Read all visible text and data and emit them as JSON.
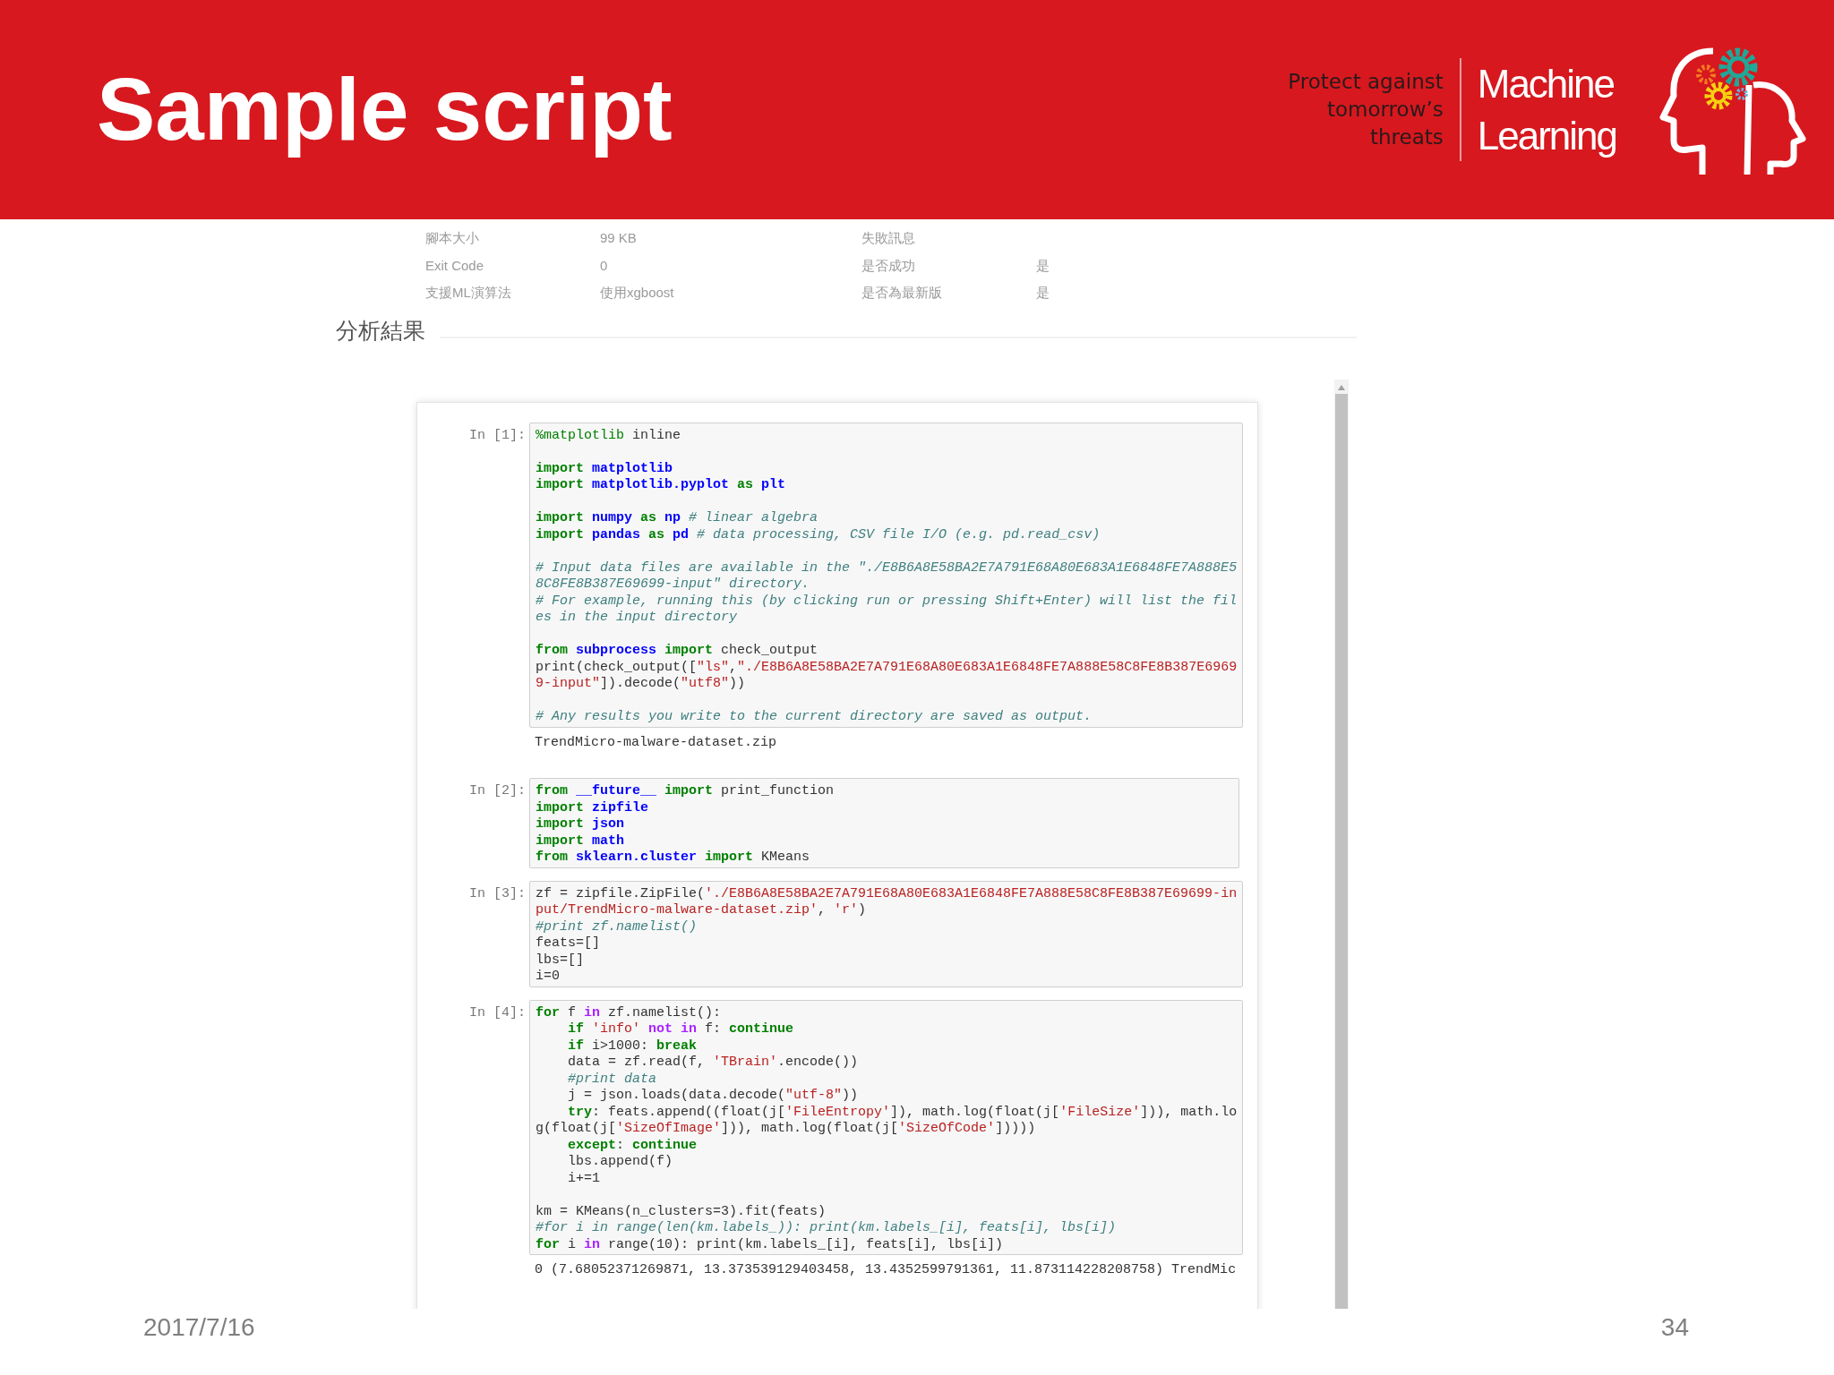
{
  "slide": {
    "title": "Sample script",
    "tagline": [
      "Protect against",
      "tomorrow’s",
      "threats"
    ],
    "brand": [
      "Machine",
      "Learning"
    ],
    "date": "2017/7/16",
    "page_number": "34"
  },
  "info_table": [
    {
      "label": "腳本大小",
      "value": "99 KB",
      "label_2": "失敗訊息"
    },
    {
      "label": "Exit Code",
      "value": "0",
      "label_2": "是否成功",
      "value_2": "是"
    },
    {
      "label": "支援ML演算法",
      "value": "使用xgboost",
      "label_2": "是否為最新版",
      "value_2": "是"
    }
  ],
  "section_heading": "分析結果",
  "cells": [
    {
      "prompt": "In [1]:",
      "lines": [
        {
          "kind": "code",
          "tokens": [
            {
              "kind": "magic",
              "text": "%matplotlib"
            },
            {
              "kind": "plain",
              "text": " inline"
            }
          ]
        },
        {
          "kind": "blank"
        },
        {
          "kind": "code",
          "tokens": [
            {
              "kind": "keyword",
              "text": "import "
            },
            {
              "kind": "name",
              "text": "matplotlib"
            }
          ]
        },
        {
          "kind": "code",
          "tokens": [
            {
              "kind": "keyword",
              "text": "import "
            },
            {
              "kind": "name",
              "text": "matplotlib.pyplot"
            },
            {
              "kind": "keyword",
              "text": " as "
            },
            {
              "kind": "name",
              "text": "plt"
            }
          ]
        },
        {
          "kind": "blank"
        },
        {
          "kind": "code",
          "tokens": [
            {
              "kind": "keyword",
              "text": "import "
            },
            {
              "kind": "name",
              "text": "numpy"
            },
            {
              "kind": "keyword",
              "text": " as "
            },
            {
              "kind": "name",
              "text": "np"
            },
            {
              "kind": "comment",
              "text": " # linear algebra"
            }
          ]
        },
        {
          "kind": "code",
          "tokens": [
            {
              "kind": "keyword",
              "text": "import "
            },
            {
              "kind": "name",
              "text": "pandas"
            },
            {
              "kind": "keyword",
              "text": " as "
            },
            {
              "kind": "name",
              "text": "pd"
            },
            {
              "kind": "comment",
              "text": " # data processing, CSV file I/O (e.g. pd.read_csv)"
            }
          ]
        },
        {
          "kind": "blank"
        },
        {
          "kind": "code",
          "tokens": [
            {
              "kind": "comment",
              "text": "# Input data files are available in the \"./E8B6A8E58BA2E7A791E68A80E683A1E6848FE7A888E5"
            }
          ]
        },
        {
          "kind": "code",
          "tokens": [
            {
              "kind": "comment",
              "text": "8C8FE8B387E69699-input\" directory."
            }
          ]
        },
        {
          "kind": "code",
          "tokens": [
            {
              "kind": "comment",
              "text": "# For example, running this (by clicking run or pressing Shift+Enter) will list the fil"
            }
          ]
        },
        {
          "kind": "code",
          "tokens": [
            {
              "kind": "comment",
              "text": "es in the input directory"
            }
          ]
        },
        {
          "kind": "blank"
        },
        {
          "kind": "code",
          "tokens": [
            {
              "kind": "keyword",
              "text": "from "
            },
            {
              "kind": "name",
              "text": "subprocess"
            },
            {
              "kind": "keyword",
              "text": " import"
            },
            {
              "kind": "plain",
              "text": " check_output"
            }
          ]
        },
        {
          "kind": "code",
          "tokens": [
            {
              "kind": "plain",
              "text": "print(check_output(["
            },
            {
              "kind": "string",
              "text": "\"ls\""
            },
            {
              "kind": "plain",
              "text": ","
            },
            {
              "kind": "string",
              "text": "\"./E8B6A8E58BA2E7A791E68A80E683A1E6848FE7A888E58C8FE8B387E6969"
            }
          ]
        },
        {
          "kind": "code",
          "tokens": [
            {
              "kind": "string",
              "text": "9-input\""
            },
            {
              "kind": "plain",
              "text": "]).decode("
            },
            {
              "kind": "string",
              "text": "\"utf8\""
            },
            {
              "kind": "plain",
              "text": "))"
            }
          ]
        },
        {
          "kind": "blank"
        },
        {
          "kind": "code",
          "tokens": [
            {
              "kind": "comment",
              "text": "# Any results you write to the current directory are saved as output."
            }
          ]
        }
      ],
      "output": "TrendMicro-malware-dataset.zip"
    },
    {
      "prompt": "In [2]:",
      "lines": [
        {
          "kind": "code",
          "tokens": [
            {
              "kind": "keyword",
              "text": "from "
            },
            {
              "kind": "name",
              "text": "__future__"
            },
            {
              "kind": "keyword",
              "text": " import"
            },
            {
              "kind": "plain",
              "text": " print_function"
            }
          ]
        },
        {
          "kind": "code",
          "tokens": [
            {
              "kind": "keyword",
              "text": "import "
            },
            {
              "kind": "name",
              "text": "zipfile"
            }
          ]
        },
        {
          "kind": "code",
          "tokens": [
            {
              "kind": "keyword",
              "text": "import "
            },
            {
              "kind": "name",
              "text": "json"
            }
          ]
        },
        {
          "kind": "code",
          "tokens": [
            {
              "kind": "keyword",
              "text": "import "
            },
            {
              "kind": "name",
              "text": "math"
            }
          ]
        },
        {
          "kind": "code",
          "tokens": [
            {
              "kind": "keyword",
              "text": "from "
            },
            {
              "kind": "name",
              "text": "sklearn.cluster"
            },
            {
              "kind": "keyword",
              "text": " import"
            },
            {
              "kind": "plain",
              "text": " KMeans"
            }
          ]
        }
      ]
    },
    {
      "prompt": "In [3]:",
      "lines": [
        {
          "kind": "code",
          "tokens": [
            {
              "kind": "plain",
              "text": "zf = zipfile.ZipFile("
            },
            {
              "kind": "string",
              "text": "'./E8B6A8E58BA2E7A791E68A80E683A1E6848FE7A888E58C8FE8B387E69699-in"
            }
          ]
        },
        {
          "kind": "code",
          "tokens": [
            {
              "kind": "string",
              "text": "put/TrendMicro-malware-dataset.zip'"
            },
            {
              "kind": "plain",
              "text": ", "
            },
            {
              "kind": "string",
              "text": "'r'"
            },
            {
              "kind": "plain",
              "text": ")"
            }
          ]
        },
        {
          "kind": "code",
          "tokens": [
            {
              "kind": "comment",
              "text": "#print zf.namelist()"
            }
          ]
        },
        {
          "kind": "code",
          "tokens": [
            {
              "kind": "plain",
              "text": "feats=[]"
            }
          ]
        },
        {
          "kind": "code",
          "tokens": [
            {
              "kind": "plain",
              "text": "lbs=[]"
            }
          ]
        },
        {
          "kind": "code",
          "tokens": [
            {
              "kind": "plain",
              "text": "i=0"
            }
          ]
        }
      ]
    },
    {
      "prompt": "In [4]:",
      "lines": [
        {
          "kind": "code",
          "tokens": [
            {
              "kind": "keyword",
              "text": "for"
            },
            {
              "kind": "plain",
              "text": " f "
            },
            {
              "kind": "operator",
              "text": "in"
            },
            {
              "kind": "plain",
              "text": " zf.namelist():"
            }
          ]
        },
        {
          "kind": "code",
          "tokens": [
            {
              "kind": "keyword",
              "text": "    if "
            },
            {
              "kind": "string",
              "text": "'info'"
            },
            {
              "kind": "operator",
              "text": " not in"
            },
            {
              "kind": "plain",
              "text": " f: "
            },
            {
              "kind": "keyword",
              "text": "continue"
            }
          ]
        },
        {
          "kind": "code",
          "tokens": [
            {
              "kind": "keyword",
              "text": "    if"
            },
            {
              "kind": "plain",
              "text": " i>1000: "
            },
            {
              "kind": "keyword",
              "text": "break"
            }
          ]
        },
        {
          "kind": "code",
          "tokens": [
            {
              "kind": "plain",
              "text": "    data = zf.read(f, "
            },
            {
              "kind": "string",
              "text": "'TBrain'"
            },
            {
              "kind": "plain",
              "text": ".encode())"
            }
          ]
        },
        {
          "kind": "code",
          "tokens": [
            {
              "kind": "comment",
              "text": "    #print data"
            }
          ]
        },
        {
          "kind": "code",
          "tokens": [
            {
              "kind": "plain",
              "text": "    j = json.loads(data.decode("
            },
            {
              "kind": "string",
              "text": "\"utf-8\""
            },
            {
              "kind": "plain",
              "text": "))"
            }
          ]
        },
        {
          "kind": "code",
          "tokens": [
            {
              "kind": "keyword",
              "text": "    try"
            },
            {
              "kind": "plain",
              "text": ": feats.append((float(j["
            },
            {
              "kind": "string",
              "text": "'FileEntropy'"
            },
            {
              "kind": "plain",
              "text": "]), math.log(float(j["
            },
            {
              "kind": "string",
              "text": "'FileSize'"
            },
            {
              "kind": "plain",
              "text": "])), math.lo"
            }
          ]
        },
        {
          "kind": "code",
          "tokens": [
            {
              "kind": "plain",
              "text": "g(float(j["
            },
            {
              "kind": "string",
              "text": "'SizeOfImage'"
            },
            {
              "kind": "plain",
              "text": "])), math.log(float(j["
            },
            {
              "kind": "string",
              "text": "'SizeOfCode'"
            },
            {
              "kind": "plain",
              "text": "]))))"
            }
          ]
        },
        {
          "kind": "code",
          "tokens": [
            {
              "kind": "keyword",
              "text": "    except"
            },
            {
              "kind": "plain",
              "text": ": "
            },
            {
              "kind": "keyword",
              "text": "continue"
            }
          ]
        },
        {
          "kind": "code",
          "tokens": [
            {
              "kind": "plain",
              "text": "    lbs.append(f)"
            }
          ]
        },
        {
          "kind": "code",
          "tokens": [
            {
              "kind": "plain",
              "text": "    i+=1"
            }
          ]
        },
        {
          "kind": "blank"
        },
        {
          "kind": "code",
          "tokens": [
            {
              "kind": "plain",
              "text": "km = KMeans(n_clusters=3).fit(feats)"
            }
          ]
        },
        {
          "kind": "code",
          "tokens": [
            {
              "kind": "comment",
              "text": "#for i in range(len(km.labels_)): print(km.labels_[i], feats[i], lbs[i])"
            }
          ]
        },
        {
          "kind": "code",
          "tokens": [
            {
              "kind": "keyword",
              "text": "for"
            },
            {
              "kind": "plain",
              "text": " i "
            },
            {
              "kind": "operator",
              "text": "in"
            },
            {
              "kind": "plain",
              "text": " range(10): print(km.labels_[i], feats[i], lbs[i])"
            }
          ]
        }
      ],
      "output": "0 (7.68052371269871, 13.373539129403458, 13.4352599791361, 11.873114228208758) TrendMic"
    }
  ]
}
